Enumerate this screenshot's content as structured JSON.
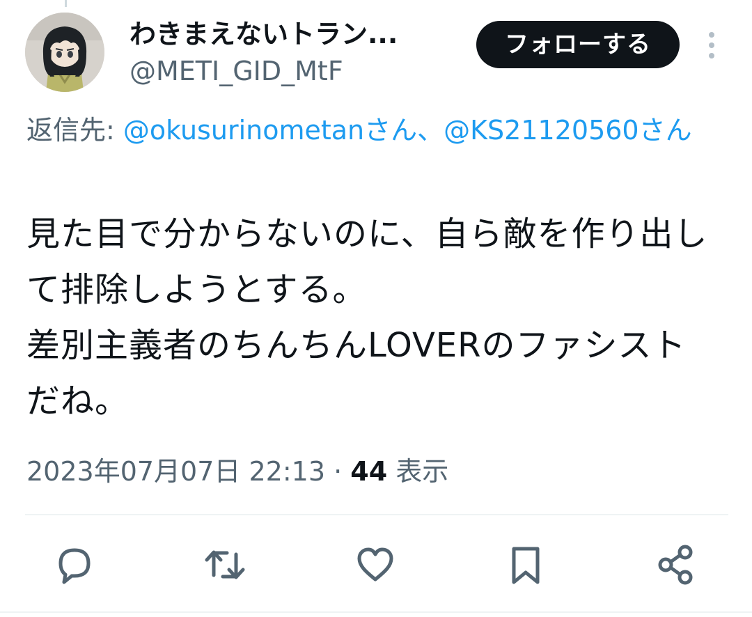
{
  "user": {
    "display_name": "わきまえないトラン...",
    "handle": "@METI_GID_MtF"
  },
  "header": {
    "follow_label": "フォローする"
  },
  "reply": {
    "prefix": "返信先: ",
    "mention_1": "@okusurinometanさん",
    "separator": "、",
    "mention_2": "@KS21120560さん"
  },
  "tweet": {
    "text": "見た目で分からないのに、自ら敵を作り出して排除しようとする。\n差別主義者のちんちんLOVERのファシスト\nだね。"
  },
  "meta": {
    "timestamp": "2023年07月07日 22:13",
    "separator": " · ",
    "views_count": "44",
    "views_label": " 表示"
  },
  "actions": {
    "reply_icon": "reply-icon",
    "retweet_icon": "retweet-icon",
    "like_icon": "like-icon",
    "bookmark_icon": "bookmark-icon",
    "share_icon": "share-icon"
  },
  "colors": {
    "text_primary": "#0f1419",
    "text_secondary": "#536471",
    "link": "#1d9bf0",
    "follow_button_bg": "#0f1419",
    "divider": "#eff3f4"
  }
}
